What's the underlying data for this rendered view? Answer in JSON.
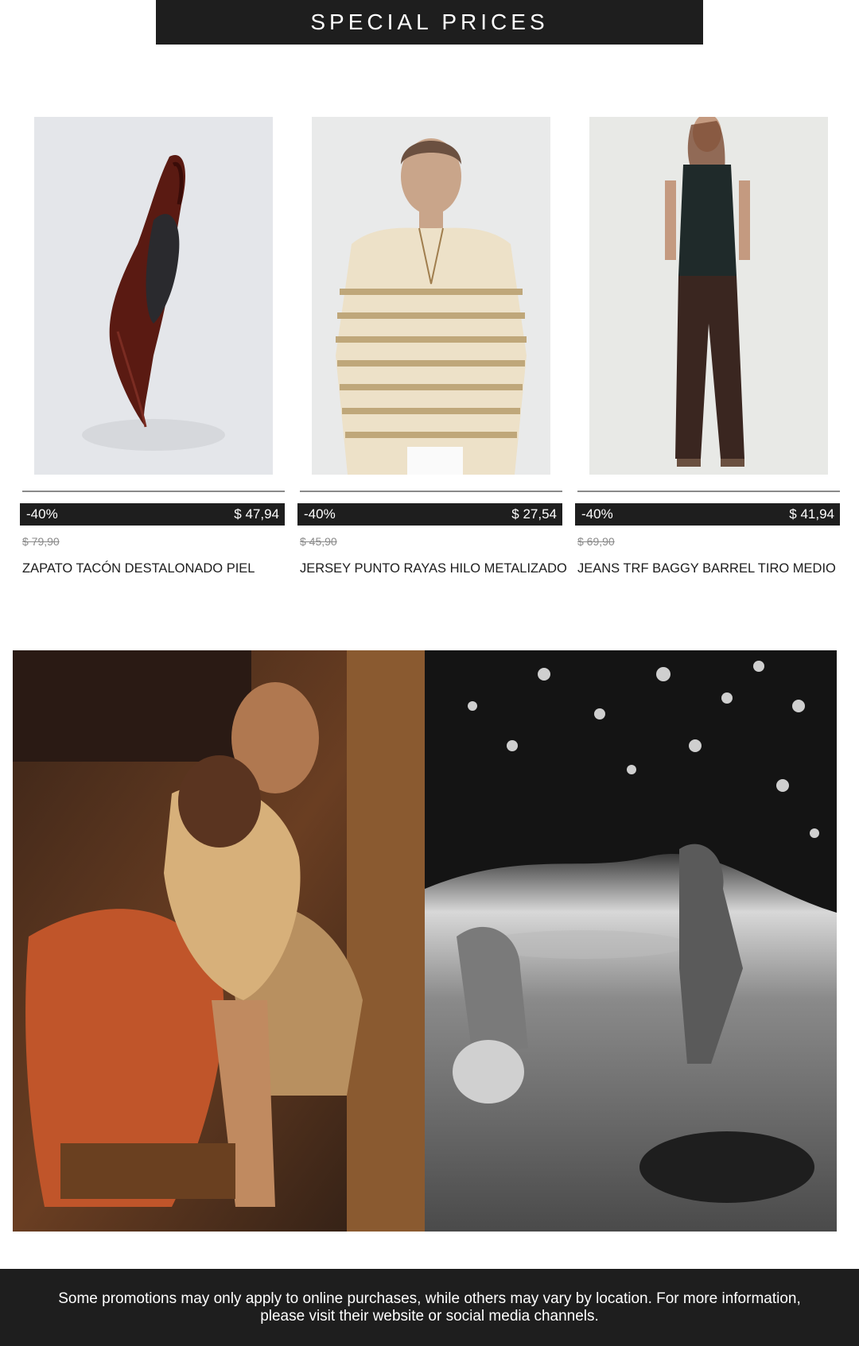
{
  "banner": {
    "title": "SPECIAL PRICES"
  },
  "products": [
    {
      "discount": "-40%",
      "price": "$ 47,94",
      "old_price": "$ 79,90",
      "name": "ZAPATO TACÓN DESTALONADO PIEL",
      "image": "slingback-heel-shoe"
    },
    {
      "discount": "-40%",
      "price": "$ 27,54",
      "old_price": "$ 45,90",
      "name": "JERSEY PUNTO RAYAS HILO METALIZADO",
      "image": "striped-knit-sweater-model"
    },
    {
      "discount": "-40%",
      "price": "$ 41,94",
      "old_price": "$ 69,90",
      "name": "JEANS TRF BAGGY BARREL TIRO MEDIO",
      "image": "baggy-jeans-model"
    }
  ],
  "lifestyle": [
    {
      "image": "mother-child-armchair-photo"
    },
    {
      "image": "garden-dancing-bw-photo"
    }
  ],
  "footer": {
    "text": "Some promotions may only apply to online purchases, while others may vary by location. For more information, please visit their website or social media channels."
  },
  "colors": {
    "dark": "#1e1e1e",
    "white": "#ffffff",
    "muted": "#8a8a8a"
  }
}
